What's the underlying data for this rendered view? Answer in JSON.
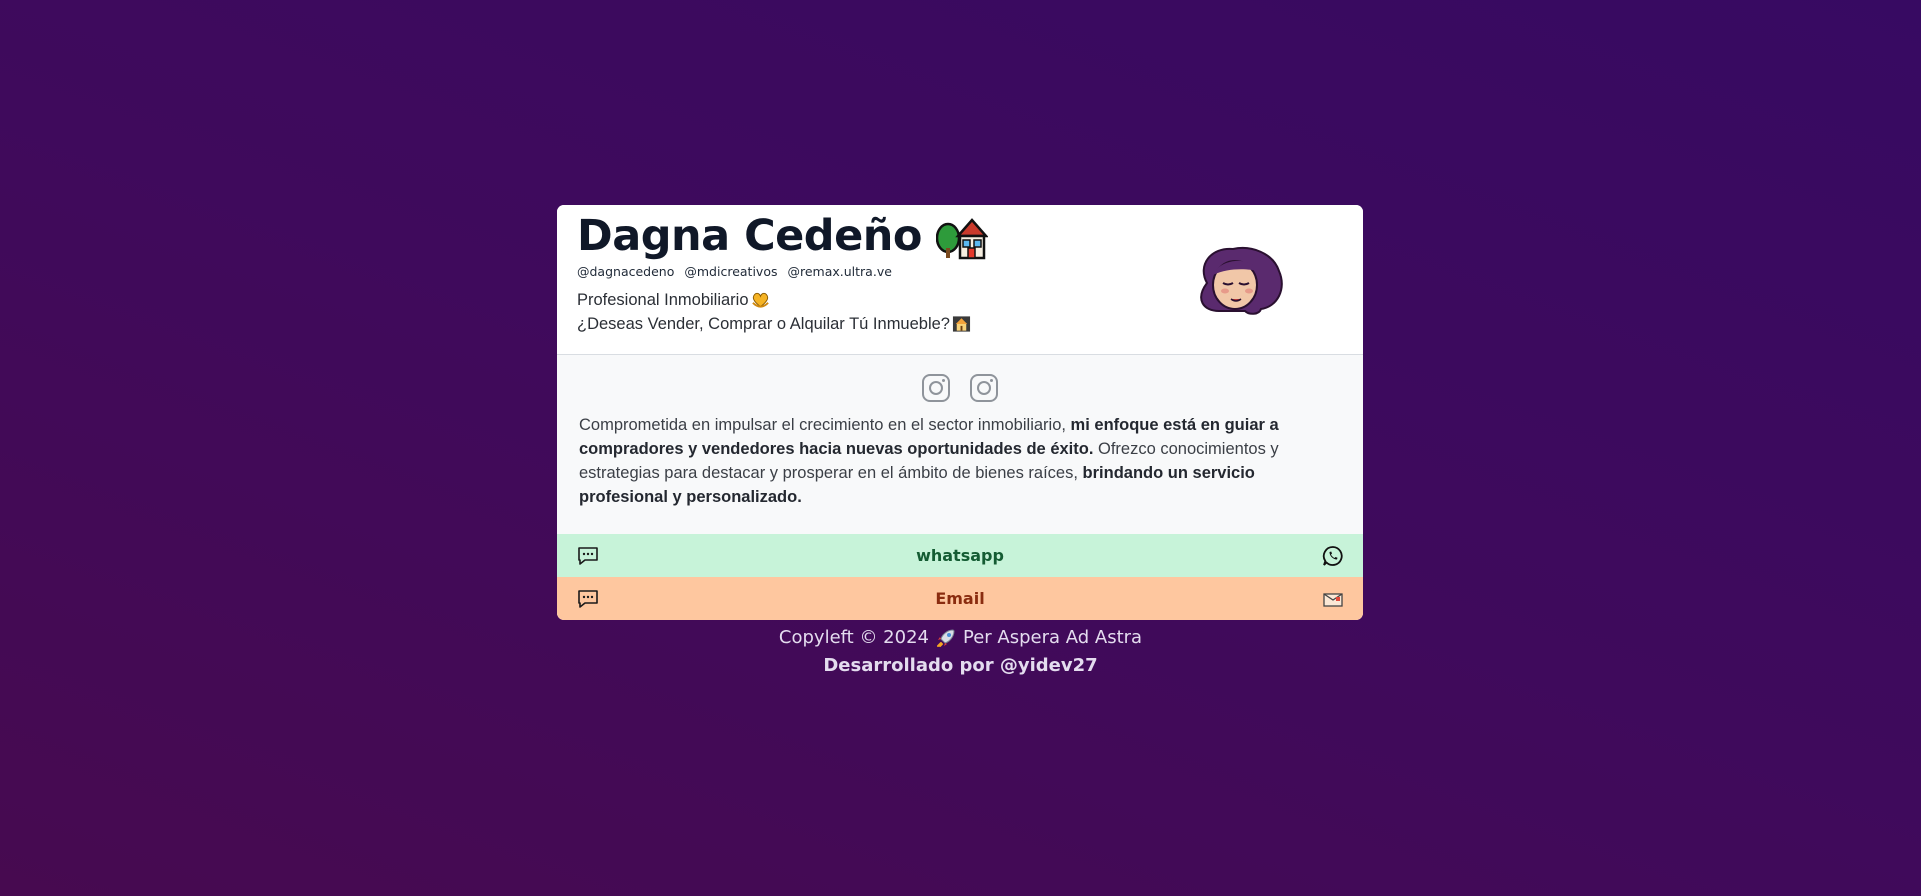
{
  "profile": {
    "name": "Dagna Cedeño",
    "name_icon": "house-with-garden-icon",
    "handles": [
      "@dagnacedeno",
      "@mdicreativos",
      "@remax.ultra.ve"
    ],
    "subtitle_line1": "Profesional Inmobiliario",
    "subtitle_line1_icon": "yellow-heart-hands-icon",
    "subtitle_line2": "¿Deseas Vender, Comprar o Alquilar Tú Inmueble?",
    "subtitle_line2_icon": "house-building-icon",
    "avatar_icon": "woman-face-avatar-icon"
  },
  "social": [
    {
      "icon": "instagram-icon"
    },
    {
      "icon": "instagram-icon"
    }
  ],
  "bio": {
    "part1": "Comprometida en impulsar el crecimiento en el sector inmobiliario, ",
    "bold1": "mi enfoque está en guiar a compradores y vendedores hacia nuevas oportunidades de éxito.",
    "part2": " Ofrezco conocimientos y estrategias para destacar y prosperar en el ámbito de bienes raíces, ",
    "bold2": "brindando un servicio profesional y personalizado."
  },
  "buttons": {
    "whatsapp": {
      "label": "whatsapp",
      "left_icon": "chat-bubble-icon",
      "right_icon": "whatsapp-icon",
      "color": "#c7f3d9"
    },
    "email": {
      "label": "Email",
      "left_icon": "chat-bubble-icon",
      "right_icon": "envelope-icon",
      "color": "#fec79f"
    }
  },
  "footer": {
    "line1_prefix": "Copyleft © 2024",
    "line1_icon": "rocket-icon",
    "line1_suffix": "Per Aspera Ad Astra",
    "line2": "Desarrollado por @yidev27"
  }
}
